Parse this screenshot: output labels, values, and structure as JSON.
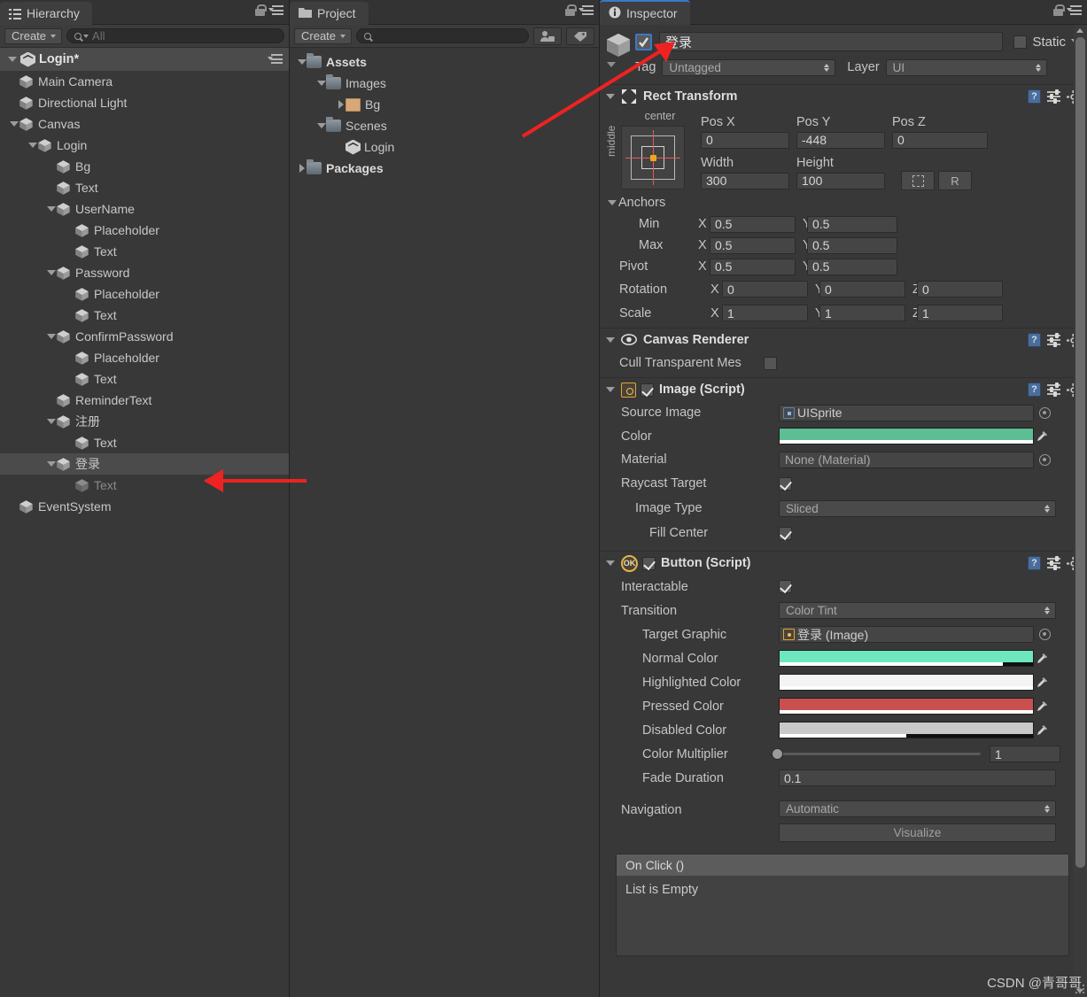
{
  "hierarchy": {
    "tab_label": "Hierarchy",
    "tab_icon": "hierarchy-list-icon",
    "create_label": "Create",
    "search_placeholder": "All",
    "scene_name": "Login*",
    "items": [
      {
        "label": "Main Camera",
        "depth": 1,
        "arrow": "none",
        "selected": false,
        "dim": false
      },
      {
        "label": "Directional Light",
        "depth": 1,
        "arrow": "none",
        "selected": false,
        "dim": false
      },
      {
        "label": "Canvas",
        "depth": 1,
        "arrow": "open",
        "selected": false,
        "dim": false
      },
      {
        "label": "Login",
        "depth": 2,
        "arrow": "open",
        "selected": false,
        "dim": false
      },
      {
        "label": "Bg",
        "depth": 3,
        "arrow": "none",
        "selected": false,
        "dim": false
      },
      {
        "label": "Text",
        "depth": 3,
        "arrow": "none",
        "selected": false,
        "dim": false
      },
      {
        "label": "UserName",
        "depth": 3,
        "arrow": "open",
        "selected": false,
        "dim": false
      },
      {
        "label": "Placeholder",
        "depth": 4,
        "arrow": "none",
        "selected": false,
        "dim": false
      },
      {
        "label": "Text",
        "depth": 4,
        "arrow": "none",
        "selected": false,
        "dim": false
      },
      {
        "label": "Password",
        "depth": 3,
        "arrow": "open",
        "selected": false,
        "dim": false
      },
      {
        "label": "Placeholder",
        "depth": 4,
        "arrow": "none",
        "selected": false,
        "dim": false
      },
      {
        "label": "Text",
        "depth": 4,
        "arrow": "none",
        "selected": false,
        "dim": false
      },
      {
        "label": "ConfirmPassword",
        "depth": 3,
        "arrow": "open",
        "selected": false,
        "dim": false
      },
      {
        "label": "Placeholder",
        "depth": 4,
        "arrow": "none",
        "selected": false,
        "dim": false
      },
      {
        "label": "Text",
        "depth": 4,
        "arrow": "none",
        "selected": false,
        "dim": false
      },
      {
        "label": "ReminderText",
        "depth": 3,
        "arrow": "none",
        "selected": false,
        "dim": false
      },
      {
        "label": "注册",
        "depth": 3,
        "arrow": "open",
        "selected": false,
        "dim": false
      },
      {
        "label": "Text",
        "depth": 4,
        "arrow": "none",
        "selected": false,
        "dim": false
      },
      {
        "label": "登录",
        "depth": 3,
        "arrow": "open",
        "selected": true,
        "dim": false
      },
      {
        "label": "Text",
        "depth": 4,
        "arrow": "none",
        "selected": false,
        "dim": true
      },
      {
        "label": "EventSystem",
        "depth": 1,
        "arrow": "none",
        "selected": false,
        "dim": false
      }
    ]
  },
  "project": {
    "tab_label": "Project",
    "tab_icon": "folder-icon",
    "create_label": "Create",
    "search_placeholder": "",
    "filter_icons": [
      "type-filter-icon",
      "label-filter-icon"
    ],
    "items": [
      {
        "label": "Assets",
        "depth": 0,
        "arrow": "open",
        "icon": "folder-icon",
        "bold": true
      },
      {
        "label": "Images",
        "depth": 1,
        "arrow": "open",
        "icon": "folder-icon",
        "bold": false
      },
      {
        "label": "Bg",
        "depth": 2,
        "arrow": "closed",
        "icon": "sprite-icon",
        "bold": false
      },
      {
        "label": "Scenes",
        "depth": 1,
        "arrow": "open",
        "icon": "folder-icon",
        "bold": false
      },
      {
        "label": "Login",
        "depth": 2,
        "arrow": "none",
        "icon": "unity-scene-icon",
        "bold": false
      },
      {
        "label": "Packages",
        "depth": 0,
        "arrow": "closed",
        "icon": "folder-icon",
        "bold": true
      }
    ]
  },
  "inspector": {
    "tab_label": "Inspector",
    "tab_icon": "info-icon",
    "object": {
      "enabled": true,
      "name": "登录",
      "static_label": "Static",
      "static_checked": false,
      "tag_label": "Tag",
      "tag_value": "Untagged",
      "layer_label": "Layer",
      "layer_value": "UI"
    },
    "rect_transform": {
      "title": "Rect Transform",
      "anchor_preset_h": "center",
      "anchor_preset_v": "middle",
      "pos_labels": [
        "Pos X",
        "Pos Y",
        "Pos Z"
      ],
      "pos_values": [
        "0",
        "-448",
        "0"
      ],
      "size_labels": [
        "Width",
        "Height"
      ],
      "size_values": [
        "300",
        "100"
      ],
      "blueprint_button": "",
      "raw_button": "R",
      "anchors_label": "Anchors",
      "min_label": "Min",
      "min_x": "0.5",
      "min_y": "0.5",
      "max_label": "Max",
      "max_x": "0.5",
      "max_y": "0.5",
      "pivot_label": "Pivot",
      "pivot_x": "0.5",
      "pivot_y": "0.5",
      "rotation_label": "Rotation",
      "rotation": [
        "0",
        "0",
        "0"
      ],
      "scale_label": "Scale",
      "scale": [
        "1",
        "1",
        "1"
      ]
    },
    "canvas_renderer": {
      "title": "Canvas Renderer",
      "cull_label": "Cull Transparent Mes",
      "cull_checked": false
    },
    "image_script": {
      "title": "Image (Script)",
      "enabled": true,
      "source_image_label": "Source Image",
      "source_image_value": "UISprite",
      "color_label": "Color",
      "color_value": "#5dbe95",
      "color_alpha_pct": 100,
      "material_label": "Material",
      "material_value": "None (Material)",
      "raycast_label": "Raycast Target",
      "raycast_checked": true,
      "image_type_label": "Image Type",
      "image_type_value": "Sliced",
      "fill_center_label": "Fill Center",
      "fill_center_checked": true
    },
    "button_script": {
      "title": "Button (Script)",
      "enabled": true,
      "interactable_label": "Interactable",
      "interactable_checked": true,
      "transition_label": "Transition",
      "transition_value": "Color Tint",
      "target_graphic_label": "Target Graphic",
      "target_graphic_value": "登录 (Image)",
      "colors": [
        {
          "label": "Normal Color",
          "value": "#6ee7be",
          "alpha_pct": 88
        },
        {
          "label": "Highlighted Color",
          "value": "#f4f4f4",
          "alpha_pct": 100
        },
        {
          "label": "Pressed Color",
          "value": "#c8504f",
          "alpha_pct": 100
        },
        {
          "label": "Disabled Color",
          "value": "#c9c9c9",
          "alpha_pct": 50
        }
      ],
      "color_multiplier_label": "Color Multiplier",
      "color_multiplier_value": "1",
      "color_multiplier_pct": 0,
      "fade_duration_label": "Fade Duration",
      "fade_duration_value": "0.1",
      "navigation_label": "Navigation",
      "navigation_value": "Automatic",
      "visualize_label": "Visualize"
    },
    "on_click": {
      "title": "On Click ()",
      "empty_label": "List is Empty"
    }
  },
  "watermark": "CSDN @青哥哥",
  "annotations": {
    "accent_color": "#ee2222",
    "arrow_hierarchy": "points-to-selected-login-row",
    "arrow_inspector": "points-to-enabled-checkbox"
  }
}
